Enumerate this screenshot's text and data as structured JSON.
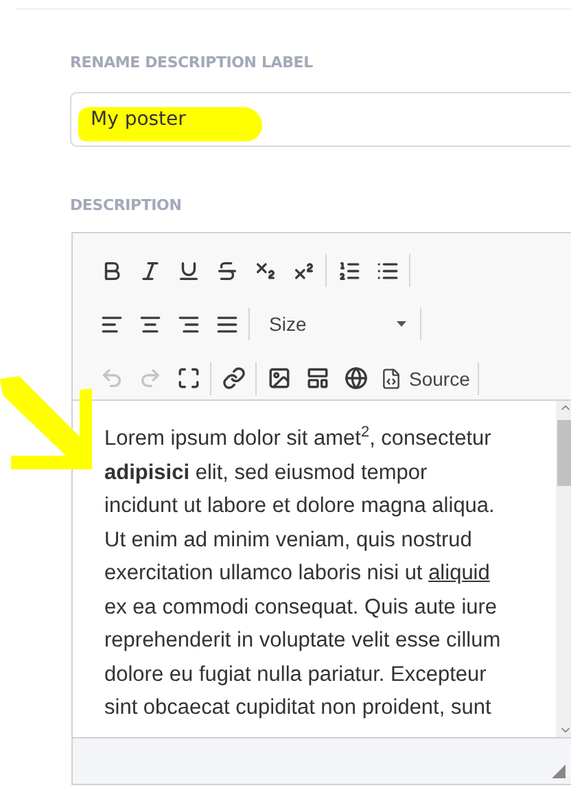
{
  "label_field": {
    "label": "RENAME DESCRIPTION LABEL",
    "value": "My poster",
    "highlighted": true
  },
  "description": {
    "label": "DESCRIPTION",
    "toolbar": [
      [
        [
          {
            "kind": "button",
            "disabled": false
          },
          {
            "kind": "button",
            "disabled": false
          },
          {
            "kind": "button",
            "disabled": false
          },
          {
            "kind": "button",
            "disabled": false
          },
          {
            "kind": "button",
            "disabled": false
          },
          {
            "kind": "button",
            "disabled": false
          }
        ],
        [
          {
            "kind": "button",
            "disabled": false
          },
          {
            "kind": "button",
            "disabled": false
          }
        ]
      ],
      [
        [
          {
            "kind": "button",
            "disabled": false
          },
          {
            "kind": "button",
            "disabled": false
          },
          {
            "kind": "button",
            "disabled": false
          },
          {
            "kind": "button",
            "disabled": false
          }
        ],
        [
          {
            "kind": "dropdown",
            "label": "Size"
          }
        ]
      ],
      [
        [
          {
            "kind": "button",
            "disabled": true
          },
          {
            "kind": "button",
            "disabled": true
          },
          {
            "kind": "button",
            "disabled": false
          }
        ],
        [
          {
            "kind": "button",
            "disabled": false
          }
        ],
        [
          {
            "kind": "button",
            "disabled": false
          },
          {
            "kind": "button",
            "disabled": false
          },
          {
            "kind": "button",
            "disabled": false
          },
          {
            "kind": "text-button",
            "label": "Source"
          }
        ]
      ]
    ],
    "lines": [
      [
        {
          "kind": "plain",
          "text": "Lorem ipsum dolor sit amet"
        },
        {
          "kind": "sup",
          "text": "2"
        },
        {
          "kind": "plain",
          "text": ", consectetur"
        }
      ],
      [
        {
          "kind": "bold",
          "text": "adipisici"
        },
        {
          "kind": "plain",
          "text": " elit, sed eiusmod tempor"
        }
      ],
      [
        {
          "kind": "plain",
          "text": "incidunt ut labore et dolore magna aliqua."
        }
      ],
      [
        {
          "kind": "plain",
          "text": "Ut enim ad minim veniam, quis nostrud"
        }
      ],
      [
        {
          "kind": "plain",
          "text": "exercitation ullamco laboris nisi ut "
        },
        {
          "kind": "underline",
          "text": "aliquid"
        }
      ],
      [
        {
          "kind": "plain",
          "text": "ex ea commodi consequat. Quis aute iure"
        }
      ],
      [
        {
          "kind": "plain",
          "text": "reprehenderit in voluptate velit esse cillum"
        }
      ],
      [
        {
          "kind": "plain",
          "text": "dolore eu fugiat nulla pariatur. Excepteur"
        }
      ],
      [
        {
          "kind": "plain",
          "text": "sint obcaecat cupiditat non proident, sunt"
        }
      ]
    ]
  },
  "annotation": {
    "kind": "arrow"
  }
}
